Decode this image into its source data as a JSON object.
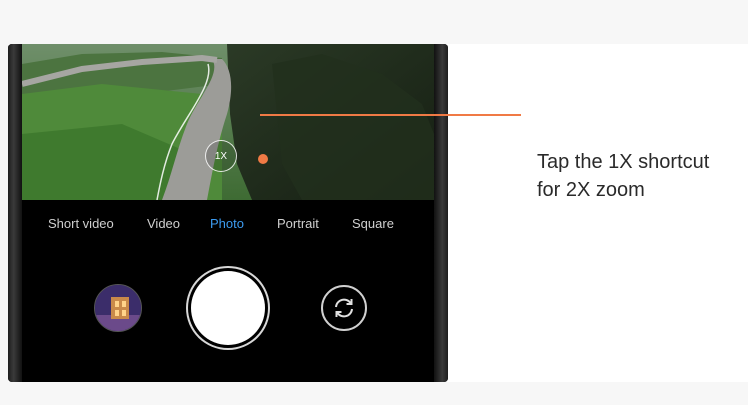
{
  "camera": {
    "zoom_label": "1X",
    "modes": [
      "Short video",
      "Video",
      "Photo",
      "Portrait",
      "Square"
    ],
    "active_mode": "Photo",
    "accent_color": "#3c9bf0"
  },
  "callout": {
    "line1": "Tap the 1X shortcut",
    "line2": "for 2X zoom",
    "color": "#f07a45"
  },
  "icons": {
    "gallery": "gallery-thumbnail",
    "shutter": "shutter-button",
    "flip": "switch-camera-icon"
  }
}
